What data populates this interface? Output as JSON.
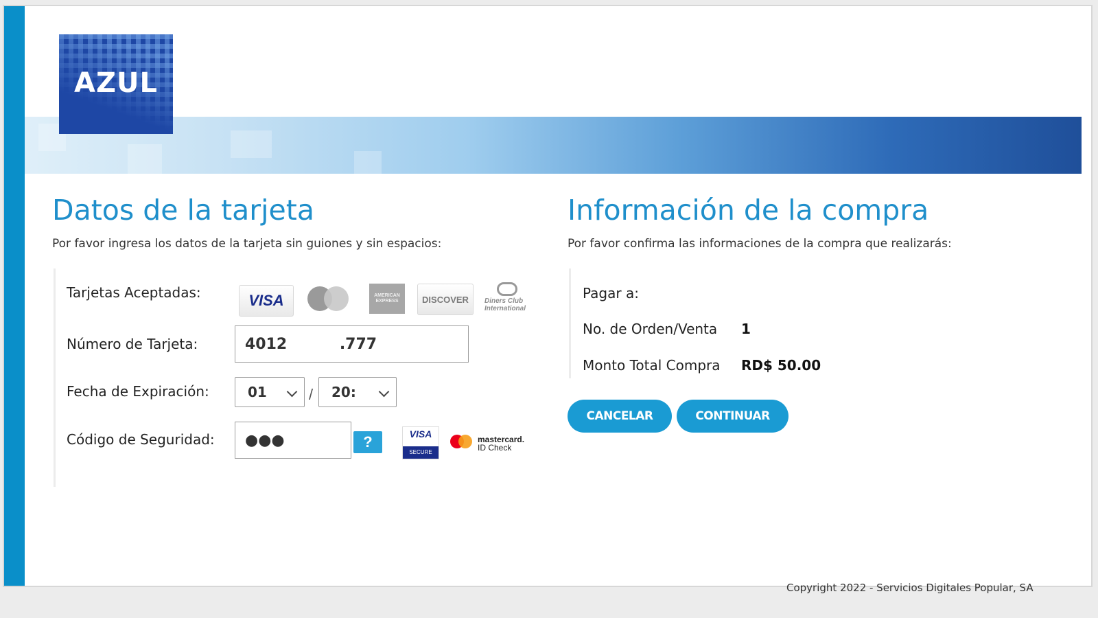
{
  "logo": {
    "text": "AZUL"
  },
  "card_section": {
    "title": "Datos de la tarjeta",
    "subtitle": "Por favor ingresa los datos de la tarjeta sin guiones y sin espacios:",
    "accepted_label": "Tarjetas Aceptadas:",
    "accepted_cards": {
      "visa": "VISA",
      "amex": "AMERICAN EXPRESS",
      "discover": "DISCOVER",
      "diners": "Diners Club International"
    },
    "number_label": "Número de Tarjeta:",
    "number_value": "4012          .777",
    "expiry_label": "Fecha de Expiración:",
    "expiry_month": "01",
    "expiry_year": "20:",
    "expiry_separator": "/",
    "cvv_label": "Código de Seguridad:",
    "cvv_value": "●●●",
    "help_label": "?",
    "visa_secure": {
      "top": "VISA",
      "bottom": "SECURE"
    },
    "mastercard_id": {
      "line1": "mastercard.",
      "line2": "ID Check"
    }
  },
  "purchase_section": {
    "title": "Información de la compra",
    "subtitle": "Por favor confirma las informaciones de la compra que realizarás:",
    "pay_to_label": "Pagar a:",
    "order_label": "No. de Orden/Venta",
    "order_value": "1",
    "total_label": "Monto Total Compra",
    "total_value": "RD$ 50.00"
  },
  "buttons": {
    "cancel": "CANCELAR",
    "continue": "CONTINUAR"
  },
  "footer": {
    "copyright": "Copyright 2022 - Servicios Digitales Popular, SA"
  },
  "colors": {
    "accent": "#1a9bd3",
    "brand": "#1e47a5",
    "stripe": "#0a8fc9"
  }
}
